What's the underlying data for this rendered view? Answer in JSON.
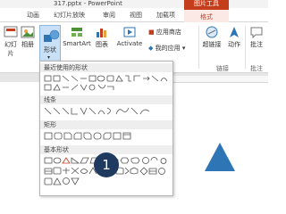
{
  "window": {
    "title": "317.pptx - PowerPoint",
    "context_group": "图片工具"
  },
  "tabs": [
    "动画",
    "幻灯片放映",
    "审阅",
    "视图",
    "加载项"
  ],
  "context_tab": "格式",
  "ribbon": {
    "new_slide": "幻灯片",
    "album": "相册",
    "shapes": "形状",
    "smartart": "SmartArt",
    "chart": "图表",
    "activate": "Activate",
    "app_store": "应用商店",
    "my_apps": "我的应用",
    "hyperlink": "超链接",
    "action": "动作",
    "comment": "批注",
    "group_links": "链接",
    "group_comments": "批注"
  },
  "gallery": {
    "recent": "最近使用的形状",
    "lines": "线条",
    "rectangles": "矩形",
    "basic": "基本形状"
  },
  "step_badge": "1",
  "colors": {
    "accent": "#2e75b6",
    "context": "#c43e1c",
    "triangle": "#2e75b6",
    "badge": "#1e3a5f"
  }
}
